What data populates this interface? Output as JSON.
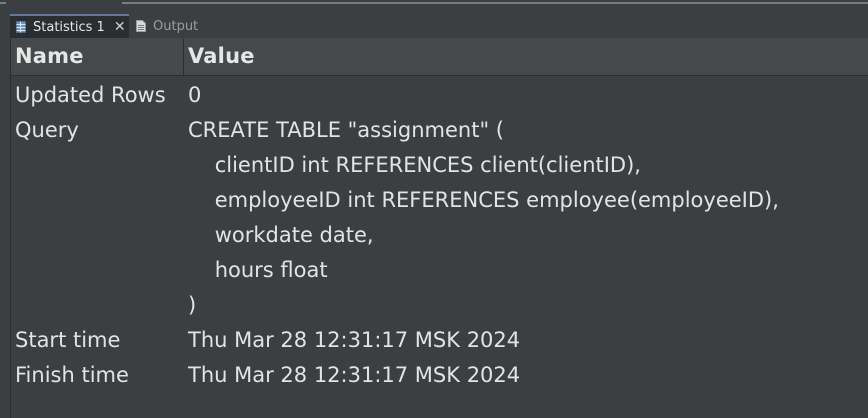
{
  "tabs": [
    {
      "label": "Statistics 1",
      "icon": "table-icon",
      "active": true
    },
    {
      "label": "Output",
      "icon": "document-icon",
      "active": false
    }
  ],
  "grid": {
    "headers": {
      "name": "Name",
      "value": "Value"
    },
    "rows": [
      {
        "name": "Updated Rows",
        "value": [
          "0"
        ]
      },
      {
        "name": "Query",
        "value": [
          "CREATE TABLE \"assignment\" (",
          "    clientID int REFERENCES client(clientID),",
          "    employeeID int REFERENCES employee(employeeID),",
          "    workdate date,",
          "    hours float",
          ")"
        ]
      },
      {
        "name": "Start time",
        "value": [
          "Thu Mar 28 12:31:17 MSK 2024"
        ]
      },
      {
        "name": "Finish time",
        "value": [
          "Thu Mar 28 12:31:17 MSK 2024"
        ]
      }
    ]
  },
  "colors": {
    "background": "#3b3f42",
    "header": "#45494c",
    "active_tab": "#2b2e30",
    "accent": "#5f7b97"
  }
}
